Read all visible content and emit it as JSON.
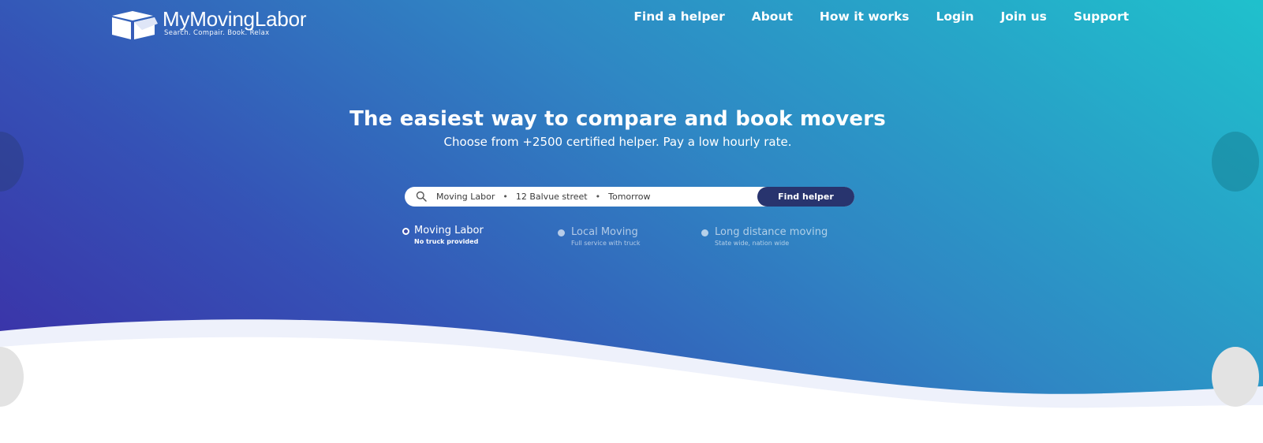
{
  "brand": {
    "name": "MyMovingLabor",
    "tagline": "Search. Compair. Book. Relax"
  },
  "nav": {
    "items": [
      {
        "label": "Find a helper"
      },
      {
        "label": "About"
      },
      {
        "label": "How it works"
      },
      {
        "label": "Login"
      },
      {
        "label": "Join us"
      },
      {
        "label": "Support"
      }
    ]
  },
  "hero": {
    "headline": "The easiest way to compare and book movers",
    "subhead": "Choose from +2500 certified helper. Pay a low hourly rate."
  },
  "search": {
    "service": "Moving Labor",
    "address": "12 Balvue street",
    "date": "Tomorrow",
    "separator": "•",
    "button_label": "Find helper"
  },
  "options": [
    {
      "title": "Moving Labor",
      "subtitle": "No truck provided",
      "selected": true
    },
    {
      "title": "Local Moving",
      "subtitle": "Full service with truck",
      "selected": false
    },
    {
      "title": "Long distance moving",
      "subtitle": "State wide, nation wide",
      "selected": false
    }
  ],
  "colors": {
    "gradient_start": "#3c2aa4",
    "gradient_end": "#1fc1cc",
    "button": "#28346e",
    "wave": "#eef1fb"
  },
  "icons": {
    "logo": "box-icon",
    "search": "search-icon",
    "carousel": "chevron-icon"
  }
}
